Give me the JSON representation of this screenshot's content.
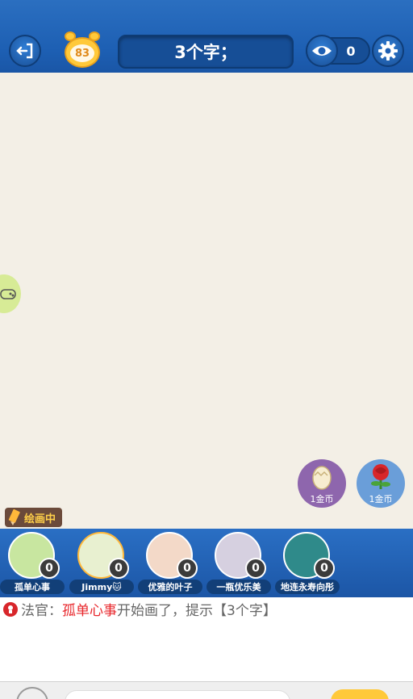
{
  "header": {
    "timer_value": "83",
    "hint": "3个字；",
    "viewer_count": "0"
  },
  "gifts": [
    {
      "name": "egg",
      "label": "1金币"
    },
    {
      "name": "rose",
      "label": "1金币"
    }
  ],
  "drawing_badge": "绘画中",
  "players": [
    {
      "name": "孤单心事",
      "score": "0",
      "avatar_color": "#c8e6a0",
      "drawer": false
    },
    {
      "name": "Jimmy🐱",
      "score": "0",
      "avatar_color": "#e8f0d0",
      "drawer": true
    },
    {
      "name": "优雅的叶子",
      "score": "0",
      "avatar_color": "#f3d9c8",
      "drawer": false
    },
    {
      "name": "一瓶优乐美",
      "score": "0",
      "avatar_color": "#d6d0e0",
      "drawer": false
    },
    {
      "name": "地连永寿向彤",
      "score": "0",
      "avatar_color": "#2f8a8a",
      "drawer": false
    }
  ],
  "chat": {
    "prefix": "法官：",
    "player": "孤单心事",
    "message": "开始画了，提示【3个字】"
  },
  "colors": {
    "header_blue": "#1d5fb3",
    "canvas_bg": "#f3efe6",
    "highlight_red": "#e8262b",
    "timer_yellow": "#ffc93a"
  }
}
